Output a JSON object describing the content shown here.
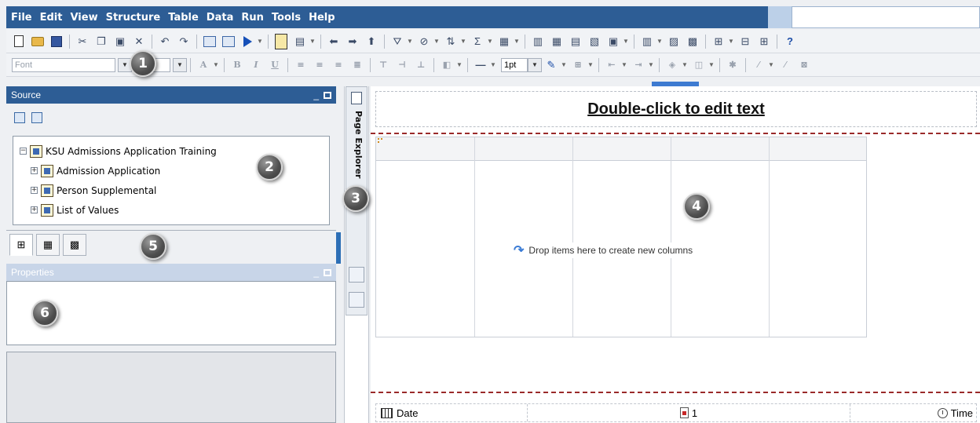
{
  "menu": {
    "items": [
      "File",
      "Edit",
      "View",
      "Structure",
      "Table",
      "Data",
      "Run",
      "Tools",
      "Help"
    ]
  },
  "toolbar": {
    "font_placeholder": "Font",
    "line_width": "1pt",
    "help_glyph": "?"
  },
  "source_panel": {
    "title": "Source",
    "tree": {
      "root": "KSU Admissions Application Training",
      "children": [
        "Admission Application",
        "Person Supplemental",
        "List of Values"
      ]
    }
  },
  "properties_panel": {
    "title": "Properties"
  },
  "page_explorer": {
    "label": "Page Explorer"
  },
  "canvas": {
    "header_text": "Double-click to edit text",
    "drop_hint": "Drop items here to create new columns",
    "footer": {
      "date": "Date",
      "page": "1",
      "time": "Time"
    }
  },
  "callouts": [
    "1",
    "2",
    "3",
    "4",
    "5",
    "6"
  ],
  "colors": {
    "title_bar": "#2d5d95",
    "accent": "#3e7bd1",
    "boundary": "#9a2a2a"
  }
}
